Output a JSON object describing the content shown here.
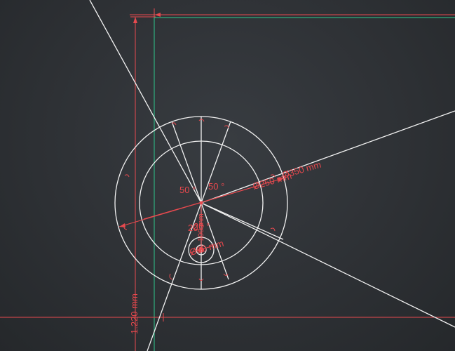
{
  "drawing": {
    "colors": {
      "background": "#2d3034",
      "geometry": "#f2f2f2",
      "dimension": "#e84a4f",
      "guide": "#2fae7e"
    },
    "dimensions": {
      "inner_diameter": "Ø250 mm",
      "outer_diameter": "Ø350 mm",
      "angle_left": "50 °",
      "angle_right": "50 °",
      "angle_bottom": "20 °",
      "angle_bottom_2": "20 °",
      "small_circle_diameter": "Ø60 mm",
      "vertical_offset": "100 mm",
      "overall_height": "1.220 mm"
    }
  }
}
